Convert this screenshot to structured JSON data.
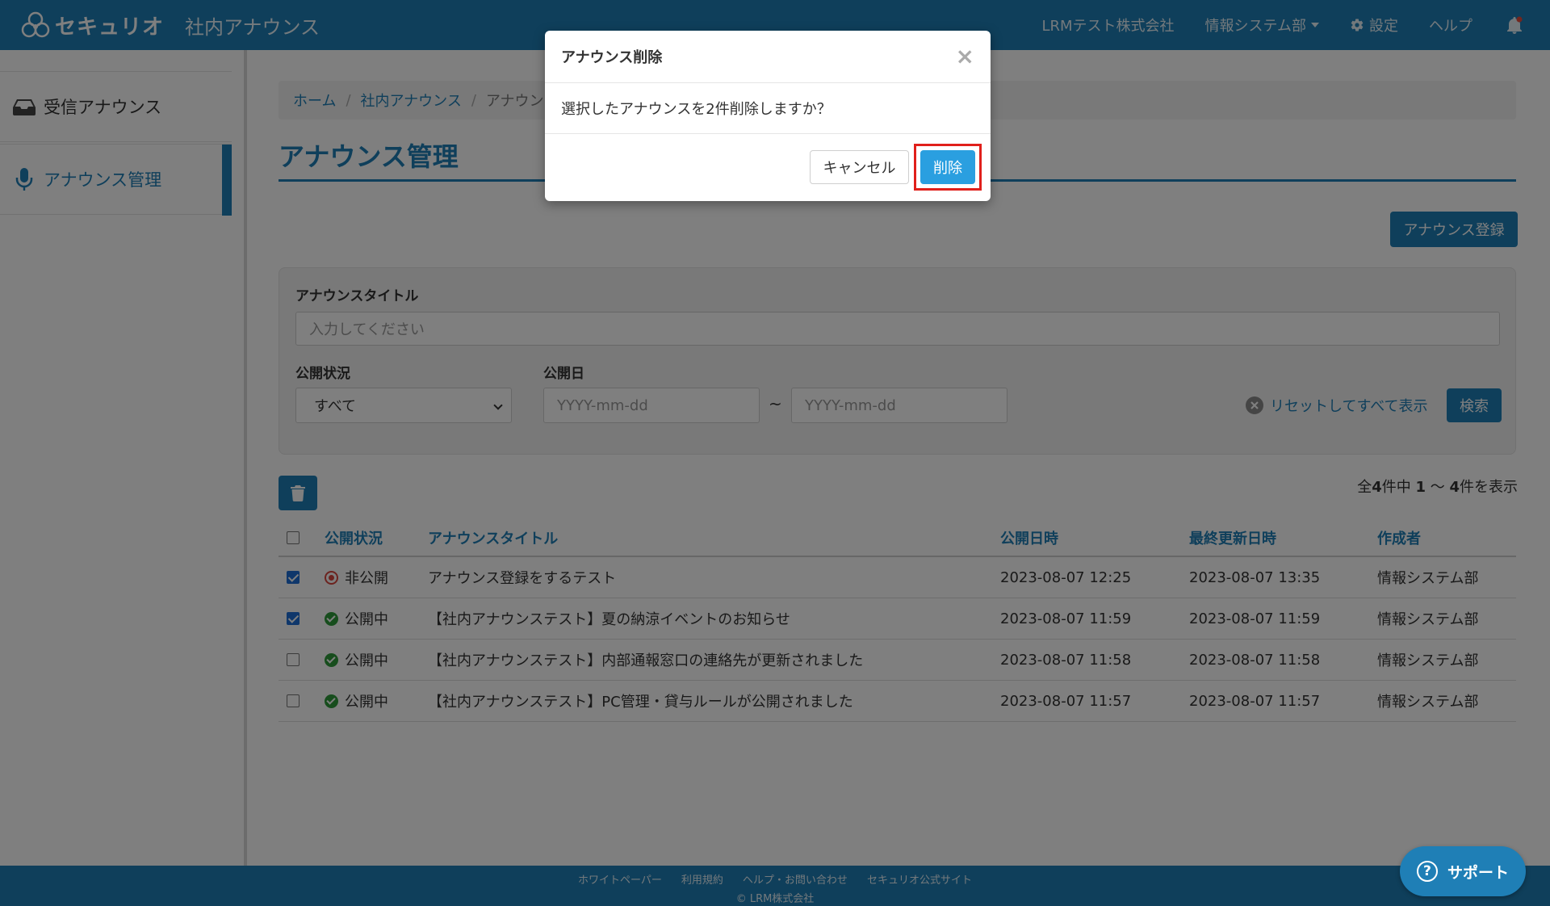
{
  "header": {
    "logo_text": "セキュリオ",
    "app_title": "社内アナウンス",
    "company": "LRMテスト株式会社",
    "department": "情報システム部",
    "settings_label": "設定",
    "help_label": "ヘルプ",
    "background": "#1f7fb6"
  },
  "sidebar": {
    "items": [
      {
        "label": "受信アナウンス",
        "icon": "inbox-icon",
        "active": false
      },
      {
        "label": "アナウンス管理",
        "icon": "microphone-icon",
        "active": true
      }
    ]
  },
  "breadcrumb": {
    "items": [
      "ホーム",
      "社内アナウンス"
    ],
    "current": "アナウン"
  },
  "page": {
    "title": "アナウンス管理",
    "register_button": "アナウンス登録"
  },
  "search": {
    "title_label": "アナウンスタイトル",
    "title_placeholder": "入力してください",
    "status_label": "公開状況",
    "status_value": "すべて",
    "date_label": "公開日",
    "date_from_placeholder": "YYYY-mm-dd",
    "date_to_placeholder": "YYYY-mm-dd",
    "tilde": "~",
    "reset_label": "リセットしてすべて表示",
    "search_button": "検索"
  },
  "results": {
    "prefix": "全",
    "total": "4",
    "mid": "件中 ",
    "range_from": "1",
    "range_sep": " 〜 ",
    "range_to": "4",
    "suffix": "件を表示"
  },
  "table": {
    "columns": [
      "公開状況",
      "アナウンスタイトル",
      "公開日時",
      "最終更新日時",
      "作成者"
    ],
    "rows": [
      {
        "checked": true,
        "status": "非公開",
        "status_type": "unpublished",
        "title": "アナウンス登録をするテスト",
        "published": "2023-08-07 12:25",
        "updated": "2023-08-07 13:35",
        "author": "情報システム部"
      },
      {
        "checked": true,
        "status": "公開中",
        "status_type": "published",
        "title": "【社内アナウンステスト】夏の納涼イベントのお知らせ",
        "published": "2023-08-07 11:59",
        "updated": "2023-08-07 11:59",
        "author": "情報システム部"
      },
      {
        "checked": false,
        "status": "公開中",
        "status_type": "published",
        "title": "【社内アナウンステスト】内部通報窓口の連絡先が更新されました",
        "published": "2023-08-07 11:58",
        "updated": "2023-08-07 11:58",
        "author": "情報システム部"
      },
      {
        "checked": false,
        "status": "公開中",
        "status_type": "published",
        "title": "【社内アナウンステスト】PC管理・貸与ルールが公開されました",
        "published": "2023-08-07 11:57",
        "updated": "2023-08-07 11:57",
        "author": "情報システム部"
      }
    ]
  },
  "footer": {
    "links": [
      "ホワイトペーパー",
      "利用規約",
      "ヘルプ・お問い合わせ",
      "セキュリオ公式サイト"
    ],
    "copyright": "© LRM株式会社"
  },
  "support": {
    "label": "サポート"
  },
  "modal": {
    "title": "アナウンス削除",
    "message": "選択したアナウンスを2件削除しますか？",
    "cancel_label": "キャンセル",
    "delete_label": "削除",
    "close_symbol": "×",
    "highlight_color": "#e0201b"
  }
}
